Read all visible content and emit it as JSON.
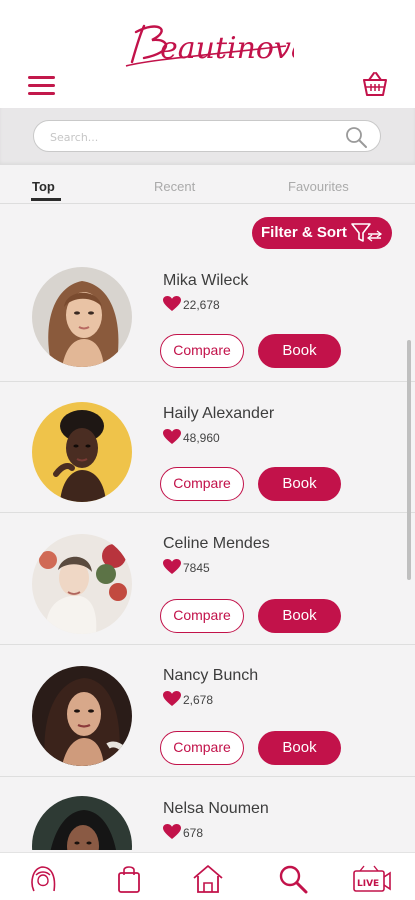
{
  "app": {
    "brand": "Beautinova",
    "accent": "#c2124a"
  },
  "header": {
    "menu_icon": "hamburger-menu-icon",
    "cart_icon": "shopping-basket-icon"
  },
  "search": {
    "placeholder": "Search...",
    "value": "",
    "icon": "search-icon"
  },
  "tabs": [
    {
      "label": "Top",
      "active": true
    },
    {
      "label": "Recent",
      "active": false
    },
    {
      "label": "Favourites",
      "active": false
    }
  ],
  "filter": {
    "label": "Filter & Sort",
    "icon": "filter-sort-icon"
  },
  "stylists": [
    {
      "name": "Mika Wileck",
      "likes": "22,678",
      "compare_label": "Compare",
      "book_label": "Book"
    },
    {
      "name": "Haily Alexander",
      "likes": "48,960",
      "compare_label": "Compare",
      "book_label": "Book"
    },
    {
      "name": "Celine Mendes",
      "likes": "7845",
      "compare_label": "Compare",
      "book_label": "Book"
    },
    {
      "name": "Nancy Bunch",
      "likes": "2,678",
      "compare_label": "Compare",
      "book_label": "Book"
    },
    {
      "name": "Nelsa Noumen",
      "likes": "678",
      "compare_label": "Compare",
      "book_label": "Book"
    }
  ],
  "bottom_nav": [
    {
      "icon": "beauty-face-icon"
    },
    {
      "icon": "shopping-bag-icon"
    },
    {
      "icon": "home-icon"
    },
    {
      "icon": "search-icon",
      "active": true
    },
    {
      "icon": "live-video-icon",
      "label": "LIVE"
    }
  ]
}
